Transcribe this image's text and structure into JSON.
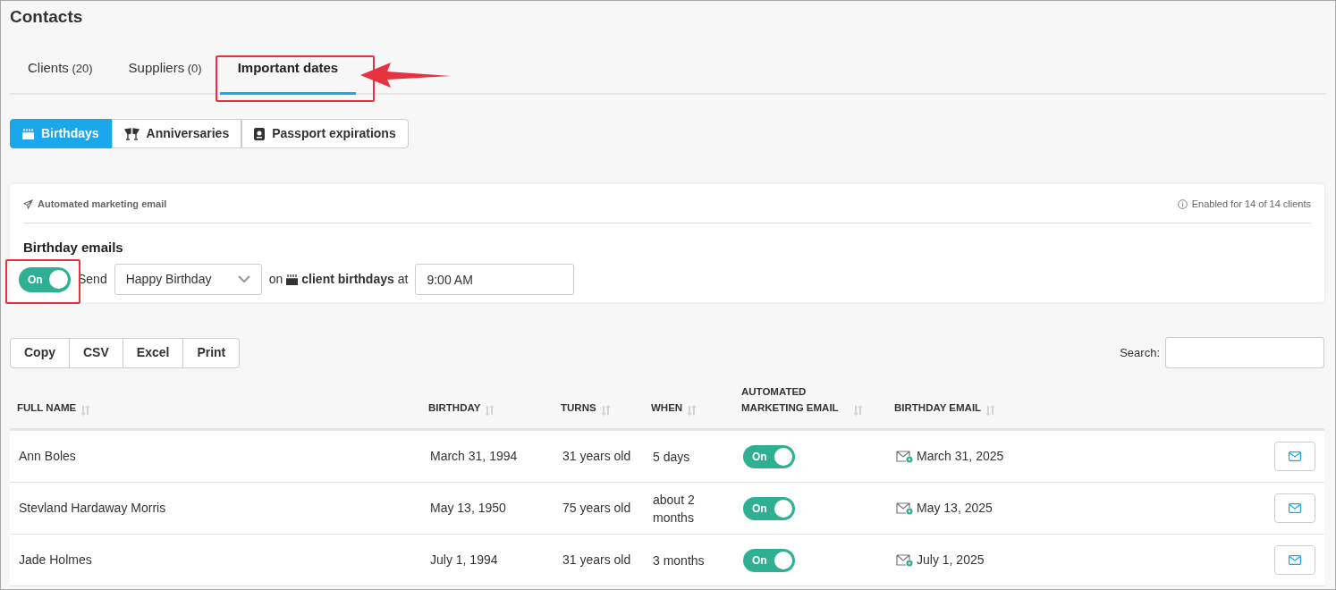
{
  "page_title": "Contacts",
  "tabs": [
    {
      "label": "Clients",
      "count": "(20)",
      "selected": false
    },
    {
      "label": "Suppliers",
      "count": "(0)",
      "selected": false
    },
    {
      "label": "Important dates",
      "selected": true
    }
  ],
  "date_types": [
    {
      "label": "Birthdays",
      "kind": "cake",
      "selected": true
    },
    {
      "label": "Anniversaries",
      "kind": "glasses",
      "selected": false
    },
    {
      "label": "Passport expirations",
      "kind": "passport",
      "selected": false
    }
  ],
  "automation_card": {
    "header": "Automated marketing email",
    "enabled_note": "Enabled for 14 of 14 clients",
    "title": "Birthday emails",
    "toggle": {
      "label": "On",
      "on": true
    },
    "send_label": "Send",
    "template": "Happy Birthday",
    "on_label": "on",
    "event_label": "client birthdays",
    "at_label": "at",
    "time": "9:00 AM"
  },
  "export_buttons": [
    "Copy",
    "CSV",
    "Excel",
    "Print"
  ],
  "search": {
    "label": "Search:"
  },
  "table": {
    "columns": [
      "FULL NAME",
      "BIRTHDAY",
      "TURNS",
      "WHEN",
      "AUTOMATED MARKETING EMAIL",
      "BIRTHDAY EMAIL"
    ],
    "rows": [
      {
        "name": "Ann Boles",
        "birthday": "March 31, 1994",
        "turns": "31 years old",
        "when": "5 days",
        "toggle": {
          "label": "On",
          "on": true
        },
        "email_date": "March 31, 2025"
      },
      {
        "name": "Stevland Hardaway Morris",
        "birthday": "May 13, 1950",
        "turns": "75 years old",
        "when": "about 2 months",
        "toggle": {
          "label": "On",
          "on": true
        },
        "email_date": "May 13, 2025"
      },
      {
        "name": "Jade Holmes",
        "birthday": "July 1, 1994",
        "turns": "31 years old",
        "when": "3 months",
        "toggle": {
          "label": "On",
          "on": true
        },
        "email_date": "July 1, 2025"
      }
    ]
  }
}
